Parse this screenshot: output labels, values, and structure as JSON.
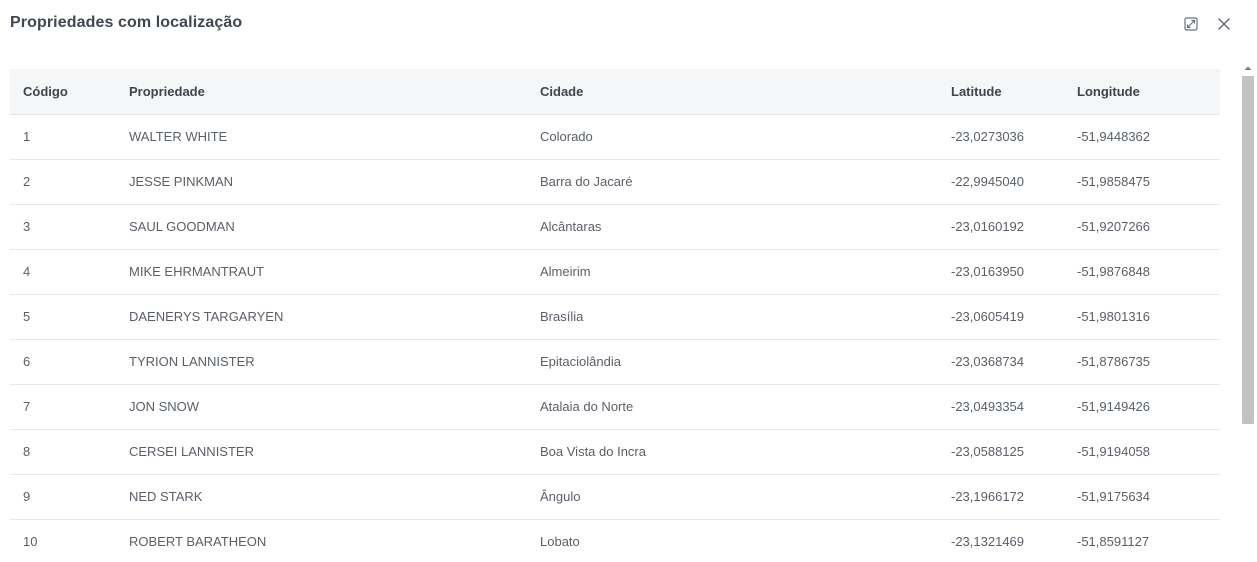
{
  "dialog": {
    "title": "Propriedades com localização"
  },
  "icons": {
    "expand": "expand-icon",
    "close": "close-icon",
    "scroll_up": "chevron-up-icon"
  },
  "table": {
    "headers": [
      "Código",
      "Propriedade",
      "Cidade",
      "Latitude",
      "Longitude"
    ],
    "rows": [
      [
        "1",
        "WALTER WHITE",
        "Colorado",
        "-23,0273036",
        "-51,9448362"
      ],
      [
        "2",
        "JESSE PINKMAN",
        "Barra do Jacaré",
        "-22,9945040",
        "-51,9858475"
      ],
      [
        "3",
        "SAUL GOODMAN",
        "Alcântaras",
        "-23,0160192",
        "-51,9207266"
      ],
      [
        "4",
        "MIKE EHRMANTRAUT",
        "Almeirim",
        "-23,0163950",
        "-51,9876848"
      ],
      [
        "5",
        "DAENERYS TARGARYEN",
        "Brasília",
        "-23,0605419",
        "-51,9801316"
      ],
      [
        "6",
        "TYRION LANNISTER",
        "Epitaciolândia",
        "-23,0368734",
        "-51,8786735"
      ],
      [
        "7",
        "JON SNOW",
        "Atalaia do Norte",
        "-23,0493354",
        "-51,9149426"
      ],
      [
        "8",
        "CERSEI LANNISTER",
        "Boa Vista do Incra",
        "-23,0588125",
        "-51,9194058"
      ],
      [
        "9",
        "NED STARK",
        "Ângulo",
        "-23,1966172",
        "-51,9175634"
      ],
      [
        "10",
        "ROBERT BARATHEON",
        "Lobato",
        "-23,1321469",
        "-51,8591127"
      ]
    ]
  }
}
